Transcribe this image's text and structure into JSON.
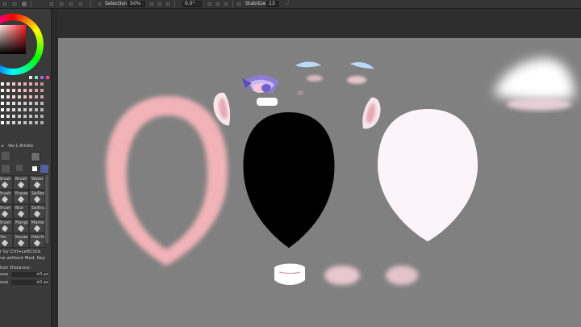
{
  "toolbar": {
    "selection_label": "Selection",
    "zoom_value": "50%",
    "rotation_value": "0.0°",
    "stabilizer_label": "Stabilizer",
    "stabilizer_value": "13"
  },
  "left_panel": {
    "tabs": [
      "Ver.1",
      "Artistic"
    ],
    "tools": [
      {
        "label": "Brush"
      },
      {
        "label": "Brush"
      },
      {
        "label": "Water Color"
      },
      {
        "label": "Brush"
      },
      {
        "label": "Eraser"
      },
      {
        "label": "SelPen"
      },
      {
        "label": "Brush"
      },
      {
        "label": "Blur"
      },
      {
        "label": "SelEra"
      },
      {
        "label": "Brush"
      },
      {
        "label": "Mango"
      },
      {
        "label": "Marker"
      },
      {
        "label": "Pen"
      },
      {
        "label": "Kavaero"
      },
      {
        "label": "Hatching"
      }
    ],
    "hint_lines": [
      "r by Ctrl+LeftClick",
      "ve without Mod. Key"
    ],
    "distance_label": "tion Distance:",
    "distance_rows": [
      {
        "label": "ove",
        "value": "±0 px"
      },
      {
        "label": "ove",
        "value": "±0 px"
      }
    ]
  },
  "colors": {
    "canvas": "#808080",
    "panel": "#3a3a3a",
    "toolbar": "#353535",
    "pink_ring": "#f0b4b8",
    "face_white": "#fbf4f8",
    "face_black": "#000000"
  }
}
